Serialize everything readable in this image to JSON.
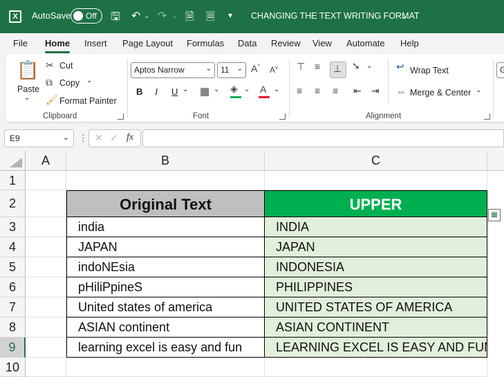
{
  "titlebar": {
    "autosave_label": "AutoSave",
    "autosave_state": "Off",
    "doc_title": "CHANGING THE TEXT WRITING FORMAT"
  },
  "menu": [
    "File",
    "Home",
    "Insert",
    "Page Layout",
    "Formulas",
    "Data",
    "Review",
    "View",
    "Automate",
    "Help"
  ],
  "active_tab": "Home",
  "ribbon": {
    "clipboard": {
      "paste": "Paste",
      "cut": "Cut",
      "copy": "Copy",
      "format_painter": "Format Painter",
      "label": "Clipboard"
    },
    "font": {
      "font_name": "Aptos Narrow",
      "font_size": "11",
      "bold": "B",
      "italic": "I",
      "underline": "U",
      "label": "Font"
    },
    "alignment": {
      "wrap_text": "Wrap Text",
      "merge_center": "Merge & Center",
      "label": "Alignment"
    },
    "number_partial": "G"
  },
  "formula_bar": {
    "name_box": "E9",
    "fx": "fx",
    "content": ""
  },
  "grid": {
    "columns": [
      "A",
      "B",
      "C"
    ],
    "rows": [
      "1",
      "2",
      "3",
      "4",
      "5",
      "6",
      "7",
      "8",
      "9",
      "10"
    ],
    "header": {
      "original": "Original Text",
      "upper": "UPPER"
    },
    "data": [
      {
        "original": "india",
        "upper": "INDIA"
      },
      {
        "original": "JAPAN",
        "upper": "JAPAN"
      },
      {
        "original": "indoNEsia",
        "upper": "INDONESIA"
      },
      {
        "original": "pHiliPpineS",
        "upper": "PHILIPPINES"
      },
      {
        "original": "United states of america",
        "upper": "UNITED STATES OF AMERICA"
      },
      {
        "original": "ASIAN continent",
        "upper": "ASIAN CONTINENT"
      },
      {
        "original": "learning excel is easy and fun",
        "upper": "LEARNING EXCEL IS EASY AND FUN"
      }
    ]
  },
  "colors": {
    "brand": "#1e7145",
    "header_gray": "#bfbfbf",
    "header_green": "#00b050",
    "result_fill": "#e2efda"
  }
}
